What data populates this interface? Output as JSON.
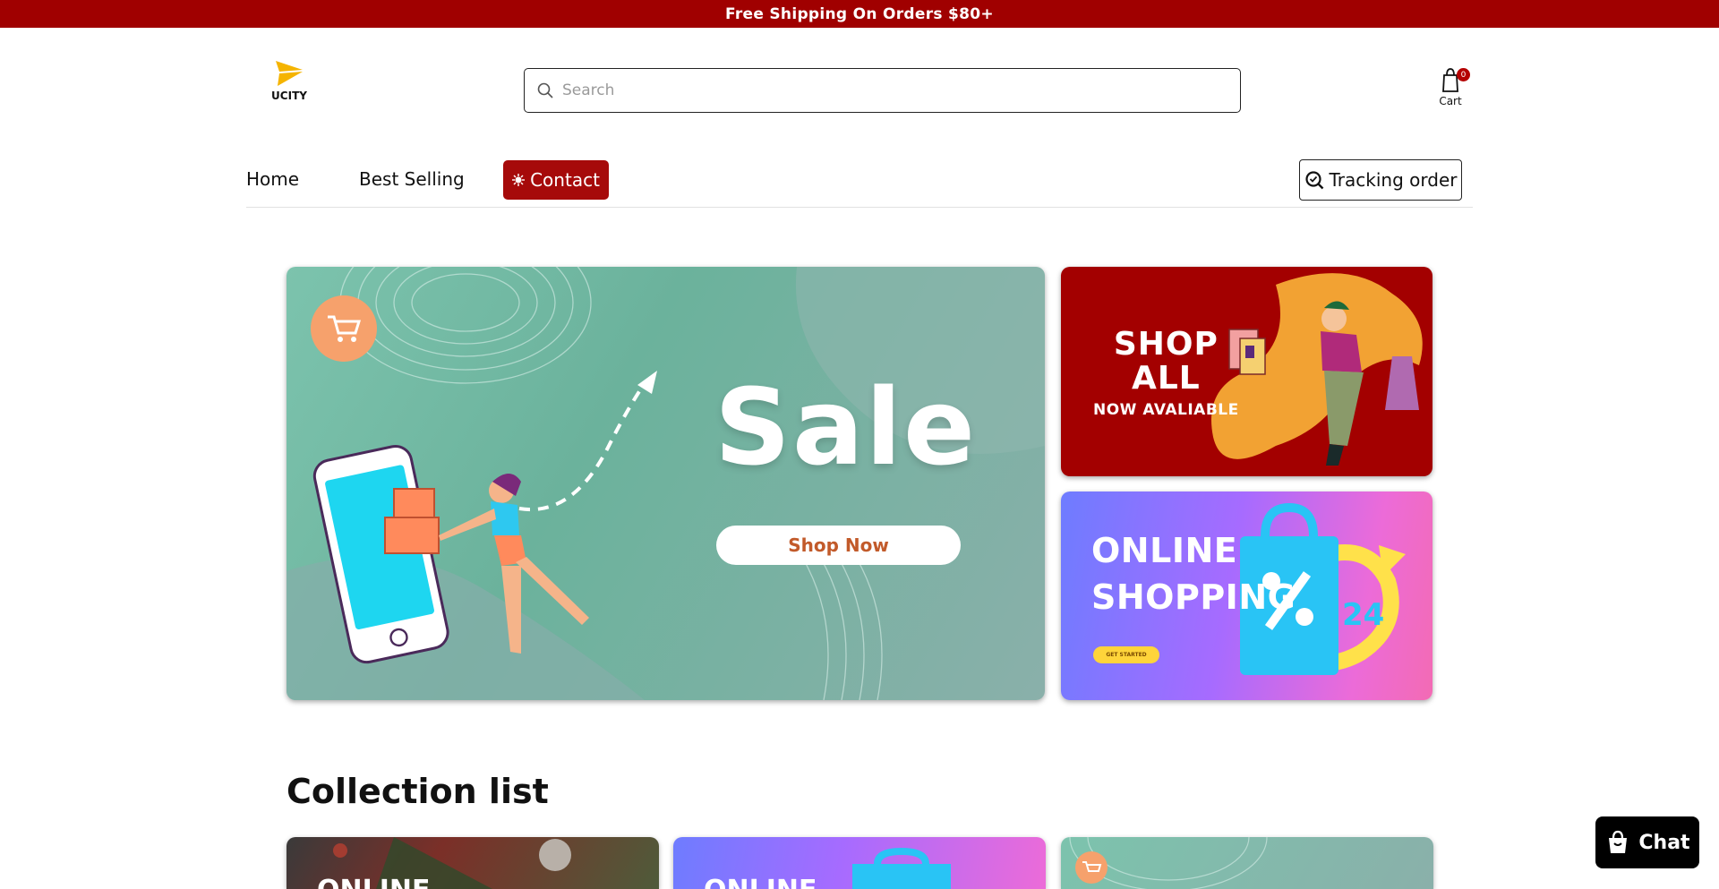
{
  "announcement": "Free Shipping On Orders $80+",
  "logo": {
    "text": "UCITY",
    "accent": "#f5b400"
  },
  "search": {
    "placeholder": "Search",
    "value": ""
  },
  "cart": {
    "label": "Cart",
    "count": "0"
  },
  "nav": {
    "items": [
      {
        "label": "Home"
      },
      {
        "label": "Best Selling"
      },
      {
        "label": "Contact"
      }
    ],
    "tracking": "Tracking order"
  },
  "banners": {
    "main": {
      "headline": "Sale",
      "cta": "Shop Now"
    },
    "shop_all": {
      "line1": "SHOP",
      "line2": "ALL",
      "sub": "NOW AVALIABLE"
    },
    "online": {
      "line1": "ONLINE",
      "line2": "SHOPPING",
      "cta": "GET STARTED",
      "badge": "24"
    }
  },
  "collection": {
    "title": "Collection list",
    "cards": [
      {
        "label": "ONLINE"
      },
      {
        "label": "ONLINE"
      },
      {
        "label": ""
      }
    ]
  },
  "chat": {
    "label": "Chat"
  },
  "colors": {
    "brand": "#a00000",
    "contact": "#a60a0a",
    "main_banner": "#7cc3ad",
    "chat": "#000000"
  }
}
